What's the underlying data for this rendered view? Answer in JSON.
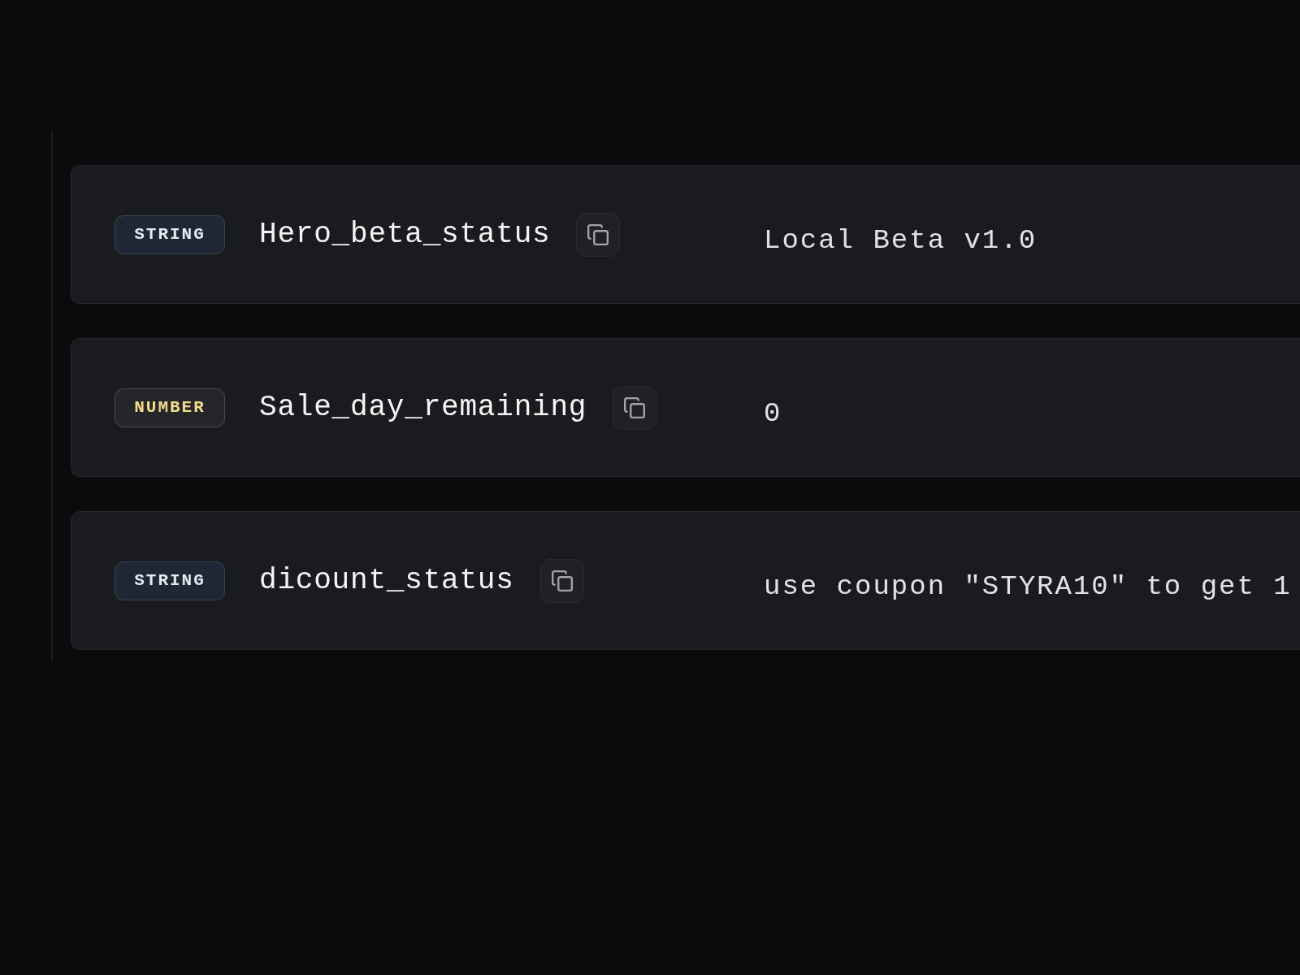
{
  "variables": [
    {
      "kind": "string",
      "type": "STRING",
      "name": "Hero_beta_status",
      "value": "Local Beta v1.0"
    },
    {
      "kind": "number",
      "type": "NUMBER",
      "name": "Sale_day_remaining",
      "value": "0"
    },
    {
      "kind": "string",
      "type": "STRING",
      "name": "dicount_status",
      "value": "use coupon \"STYRA10\" to get 1"
    }
  ]
}
